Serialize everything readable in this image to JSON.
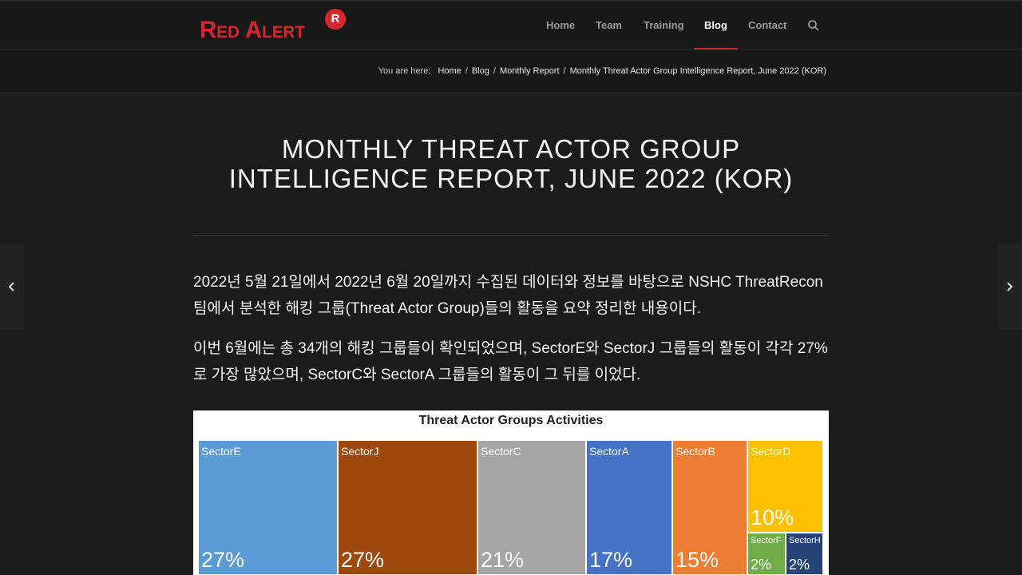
{
  "header": {
    "logo": {
      "text": "Red Alert",
      "badge": "R"
    },
    "nav": [
      {
        "label": "Home",
        "active": false
      },
      {
        "label": "Team",
        "active": false
      },
      {
        "label": "Training",
        "active": false
      },
      {
        "label": "Blog",
        "active": true
      },
      {
        "label": "Contact",
        "active": false
      }
    ],
    "accent_color": "#d7262d"
  },
  "breadcrumb": {
    "prefix": "You are here:",
    "items": [
      "Home",
      "Blog",
      "Monthly Report",
      "Monthly Threat Actor Group Intelligence Report, June 2022 (KOR)"
    ]
  },
  "article": {
    "title_line1": "MONTHLY THREAT ACTOR GROUP",
    "title_line2": "INTELLIGENCE REPORT, JUNE 2022 (KOR)",
    "paragraph1": "2022년 5월 21일에서 2022년 6월 20일까지 수집된 데이터와 정보를 바탕으로 NSHC ThreatRecon팀에서 분석한 해킹 그룹(Threat Actor Group)들의 활동을 요약 정리한 내용이다.",
    "paragraph2": "이번 6월에는 총 34개의 해킹 그룹들이 확인되었으며, SectorE와 SectorJ 그룹들의 활동이 각각 27%로 가장 많았으며, SectorC와 SectorA 그룹들의 활동이 그 뒤를 이었다."
  },
  "chart_data": {
    "type": "treemap",
    "title": "Threat Actor Groups Activities",
    "categories": [
      "SectorE",
      "SectorJ",
      "SectorC",
      "SectorA",
      "SectorB",
      "SectorD",
      "SectorF",
      "SectorH"
    ],
    "values": [
      27,
      27,
      21,
      17,
      15,
      10,
      2,
      2
    ],
    "labels": [
      "27%",
      "27%",
      "21%",
      "17%",
      "15%",
      "10%",
      "2%",
      "2%"
    ],
    "colors": [
      "#5b9bd5",
      "#9e480e",
      "#a5a5a5",
      "#4472c4",
      "#ed7d31",
      "#ffc000",
      "#70ad47",
      "#264478"
    ]
  }
}
